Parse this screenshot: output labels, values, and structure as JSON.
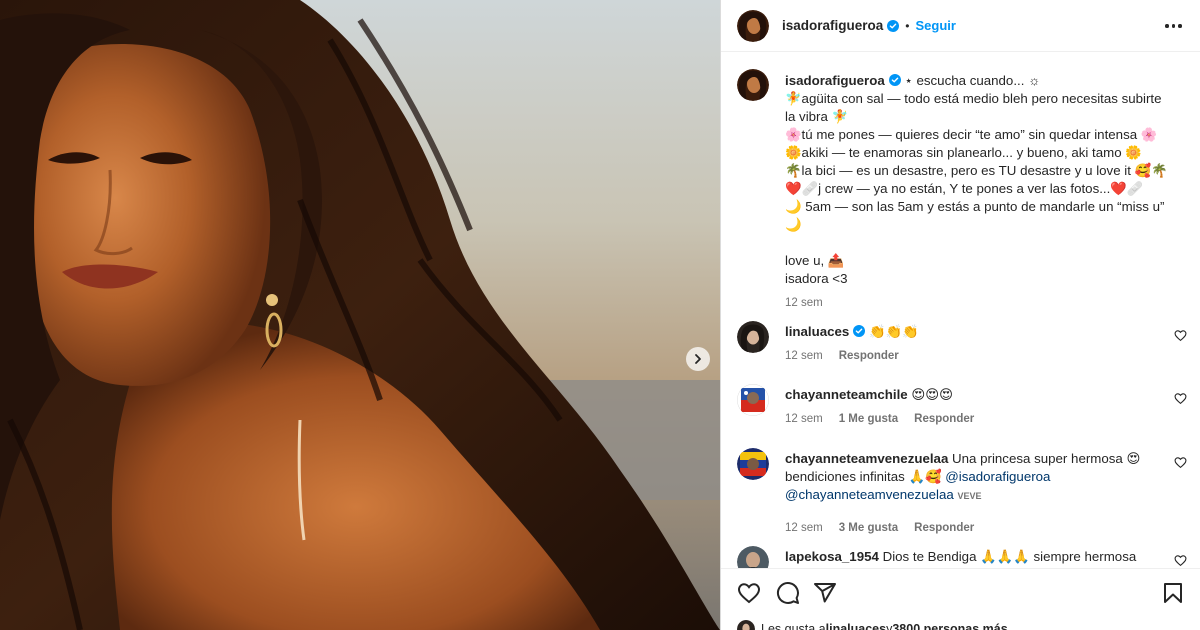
{
  "post": {
    "author": "isadorafigueroa",
    "follow_label": "Seguir",
    "separator": "•",
    "caption": {
      "username": "isadorafigueroa",
      "lines": [
        "⋆ escucha cuando... ☼",
        "🧚agüita con sal — todo está medio bleh pero necesitas subirte",
        "la vibra 🧚",
        "🌸tú me pones — quieres decir “te amo” sin quedar intensa 🌸",
        "🌼akiki — te enamoras sin planearlo... y bueno, aki tamo 🌼",
        "🌴la bici — es un desastre, pero es TU desastre y u love it 🥰🌴",
        "❤️🩹j crew — ya no están, Y te pones a ver las fotos...❤️🩹",
        "🌙 5am — son las 5am y estás a punto de mandarle un “miss u”",
        "🌙",
        "",
        "love u, 📤",
        "isadora <3"
      ],
      "time": "12 sem"
    },
    "comments": [
      {
        "username": "linaluaces",
        "verified": true,
        "text": "👏👏👏",
        "time": "12 sem",
        "likes": "",
        "reply": "Responder"
      },
      {
        "username": "chayanneteamchile",
        "verified": false,
        "text": "😍😍😍",
        "time": "12 sem",
        "likes": "1 Me gusta",
        "reply": "Responder"
      },
      {
        "username": "chayanneteamvenezuelaa",
        "verified": false,
        "text_a": "Una princesa super hermosa 😍",
        "text_b": "bendiciones infinitas 🙏🥰",
        "mention_a": "@isadorafigueroa",
        "mention_b": "@chayanneteamvenezuelaa",
        "tag": "VEVE",
        "time": "12 sem",
        "likes": "3 Me gusta",
        "reply": "Responder"
      },
      {
        "username": "lapekosa_1954",
        "verified": false,
        "text": "Dios te Bendiga 🙏🙏🙏 siempre hermosa"
      }
    ],
    "likes_line": {
      "prefix": "Les gusta a ",
      "user": "linaluaces",
      "suffix": " y ",
      "count": "3800 personas más"
    }
  },
  "colors": {
    "accent": "#0095f6",
    "text": "#262626",
    "muted": "#737373",
    "border": "#dbdbdb"
  },
  "icons": [
    "chevron-right-icon",
    "verified-badge-icon",
    "more-options-icon",
    "heart-icon",
    "comment-icon",
    "share-icon",
    "bookmark-icon"
  ]
}
